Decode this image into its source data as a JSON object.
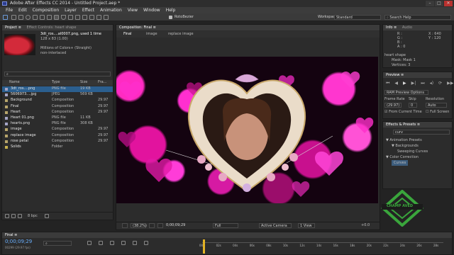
{
  "app": {
    "window_title": "Adobe After Effects CC 2014 - Untitled Project.aep *",
    "window_buttons": [
      "–",
      "□",
      "✕"
    ]
  },
  "menu": [
    "File",
    "Edit",
    "Composition",
    "Layer",
    "Effect",
    "Animation",
    "View",
    "Window",
    "Help"
  ],
  "toolbar": {
    "rotobezier_label": "RotoBezier",
    "workspace_label": "Workspace:",
    "workspace_value": "Standard",
    "search_placeholder": "Search Help"
  },
  "project_panel": {
    "tab": "Project ≡",
    "tab2": "Effect Controls: heart shape",
    "footage_name": "3dt_ros....al0007.png",
    "footage_used": ", used 1 time",
    "footage_size": "128 x 83 (1.00)",
    "footage_color": "Millions of Colors+ (Straight)",
    "footage_interlace": "non-interlaced",
    "search_placeholder": "⌕",
    "columns": {
      "name": "Name",
      "type": "Type",
      "size": "Size",
      "fps": "Fra..."
    },
    "items": [
      {
        "name": "3dt_ros....png",
        "type": "PNG file",
        "size": "19 KB",
        "fps": "",
        "color": "#a5a5c6",
        "selected": true
      },
      {
        "name": "5606973....jpg",
        "type": "JPEG",
        "size": "569 KB",
        "fps": "",
        "color": "#a5a5c6",
        "selected": false
      },
      {
        "name": "Background",
        "type": "Composition",
        "size": "",
        "fps": "29.97",
        "color": "#b7a56b",
        "selected": false
      },
      {
        "name": "Final",
        "type": "Composition",
        "size": "",
        "fps": "29.97",
        "color": "#b7a56b",
        "selected": false
      },
      {
        "name": "Heart",
        "type": "Composition",
        "size": "",
        "fps": "29.97",
        "color": "#b7a56b",
        "selected": false
      },
      {
        "name": "Heart 01.png",
        "type": "PNG file",
        "size": "11 KB",
        "fps": "",
        "color": "#a5a5c6",
        "selected": false
      },
      {
        "name": "hearts.png",
        "type": "PNG file",
        "size": "308 KB",
        "fps": "",
        "color": "#a5a5c6",
        "selected": false
      },
      {
        "name": "image",
        "type": "Composition",
        "size": "",
        "fps": "29.97",
        "color": "#b7a56b",
        "selected": false
      },
      {
        "name": "replace image",
        "type": "Composition",
        "size": "",
        "fps": "29.97",
        "color": "#b7a56b",
        "selected": false
      },
      {
        "name": "rose petal",
        "type": "Composition",
        "size": "",
        "fps": "29.97",
        "color": "#b7a56b",
        "selected": false
      },
      {
        "name": "Solids",
        "type": "Folder",
        "size": "",
        "fps": "",
        "color": "#c6b04e",
        "selected": false
      }
    ],
    "bpc": "8 bpc"
  },
  "comp_panel": {
    "tab": "Composition: Final ≡",
    "breadcrumbs": [
      "Final",
      "image",
      "replace image"
    ],
    "zoom": "(38.2%)",
    "timecode": "0;00;09;29",
    "resolution": "Full",
    "camera": "Active Camera",
    "views": "1 View",
    "exposure": "+0.0"
  },
  "info_panel": {
    "tab": "Info ≡",
    "tab2": "Audio",
    "r": "R :",
    "g": "G :",
    "b": "B :",
    "a": "A : 0",
    "x": "X : 640",
    "y": "Y : 120",
    "layer_name": "heart shape",
    "mask_line": "Mask: Mask 1",
    "vertices": "Vertices: 3"
  },
  "preview_panel": {
    "tab": "Preview ≡",
    "ram_options": "RAM Preview Options",
    "frame_rate_label": "Frame Rate",
    "skip_label": "Skip",
    "resolution_label": "Resolution",
    "frame_rate_value": "(29.97)",
    "skip_value": "0",
    "resolution_value": "Auto",
    "from_current_time": "From Current Time",
    "full_screen": "Full Screen"
  },
  "effects_panel": {
    "tab": "Effects & Presets ≡",
    "search_value": "curv",
    "tree": [
      {
        "label": "▼ Animation Presets",
        "indent": 0
      },
      {
        "label": "▼ Backgrounds",
        "indent": 1
      },
      {
        "label": "Sweeping Curves",
        "indent": 2
      },
      {
        "label": "▼ Color Correction",
        "indent": 0
      },
      {
        "label": "Curves",
        "indent": 1
      }
    ]
  },
  "timeline": {
    "tab": "Final ≡",
    "timecode": "0;00;09;29",
    "frames": "00299 (29.97 fps)",
    "ruler": [
      "00s",
      "02s",
      "04s",
      "06s",
      "08s",
      "10s",
      "12s",
      "14s",
      "16s",
      "18s",
      "20s",
      "22s",
      "24s",
      "26s",
      "28s"
    ]
  },
  "watermark": {
    "text": "CHAMP AVED"
  },
  "colors": {
    "accent_blue": "#2b8fe0",
    "viewer_pink": "#ff2fd0",
    "playhead": "#e3b325",
    "watermark_green": "#3aa63c"
  }
}
